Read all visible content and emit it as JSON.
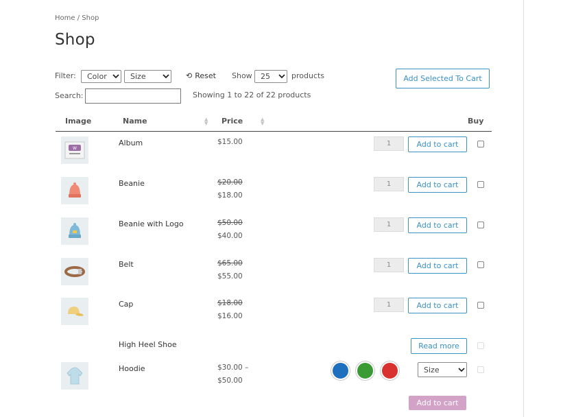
{
  "breadcrumb": "Home / Shop",
  "page_title": "Shop",
  "filter": {
    "label": "Filter:",
    "color_select": "Color",
    "size_select": "Size",
    "reset_label": "Reset"
  },
  "show": {
    "label": "Show",
    "value": "25",
    "suffix": "products"
  },
  "add_selected_label": "Add Selected To Cart",
  "search": {
    "label": "Search:",
    "value": "",
    "placeholder": ""
  },
  "showing_text": "Showing 1 to 22 of 22 products",
  "columns": {
    "image": "Image",
    "name": "Name",
    "price": "Price",
    "buy": "Buy"
  },
  "products": [
    {
      "name": "Album",
      "price": "$15.00",
      "qty": "1",
      "action": "Add to cart"
    },
    {
      "name": "Beanie",
      "old_price": "$20.00",
      "price": "$18.00",
      "qty": "1",
      "action": "Add to cart"
    },
    {
      "name": "Beanie with Logo",
      "old_price": "$50.00",
      "price": "$40.00",
      "qty": "1",
      "action": "Add to cart"
    },
    {
      "name": "Belt",
      "old_price": "$65.00",
      "price": "$55.00",
      "qty": "1",
      "action": "Add to cart"
    },
    {
      "name": "Cap",
      "old_price": "$18.00",
      "price": "$16.00",
      "qty": "1",
      "action": "Add to cart"
    },
    {
      "name": "High Heel Shoe",
      "action": "Read more"
    },
    {
      "name": "Hoodie",
      "price_from": "$30.00 –",
      "price_to": "$50.00",
      "size_select": "Size",
      "action": "Add to cart"
    }
  ],
  "swatch_colors": {
    "blue": "#1f6fbf",
    "green": "#3a9a34",
    "red": "#d8312f"
  },
  "colors": {
    "accent": "#3a91c6",
    "disabled_button": "#d3a2c7"
  }
}
